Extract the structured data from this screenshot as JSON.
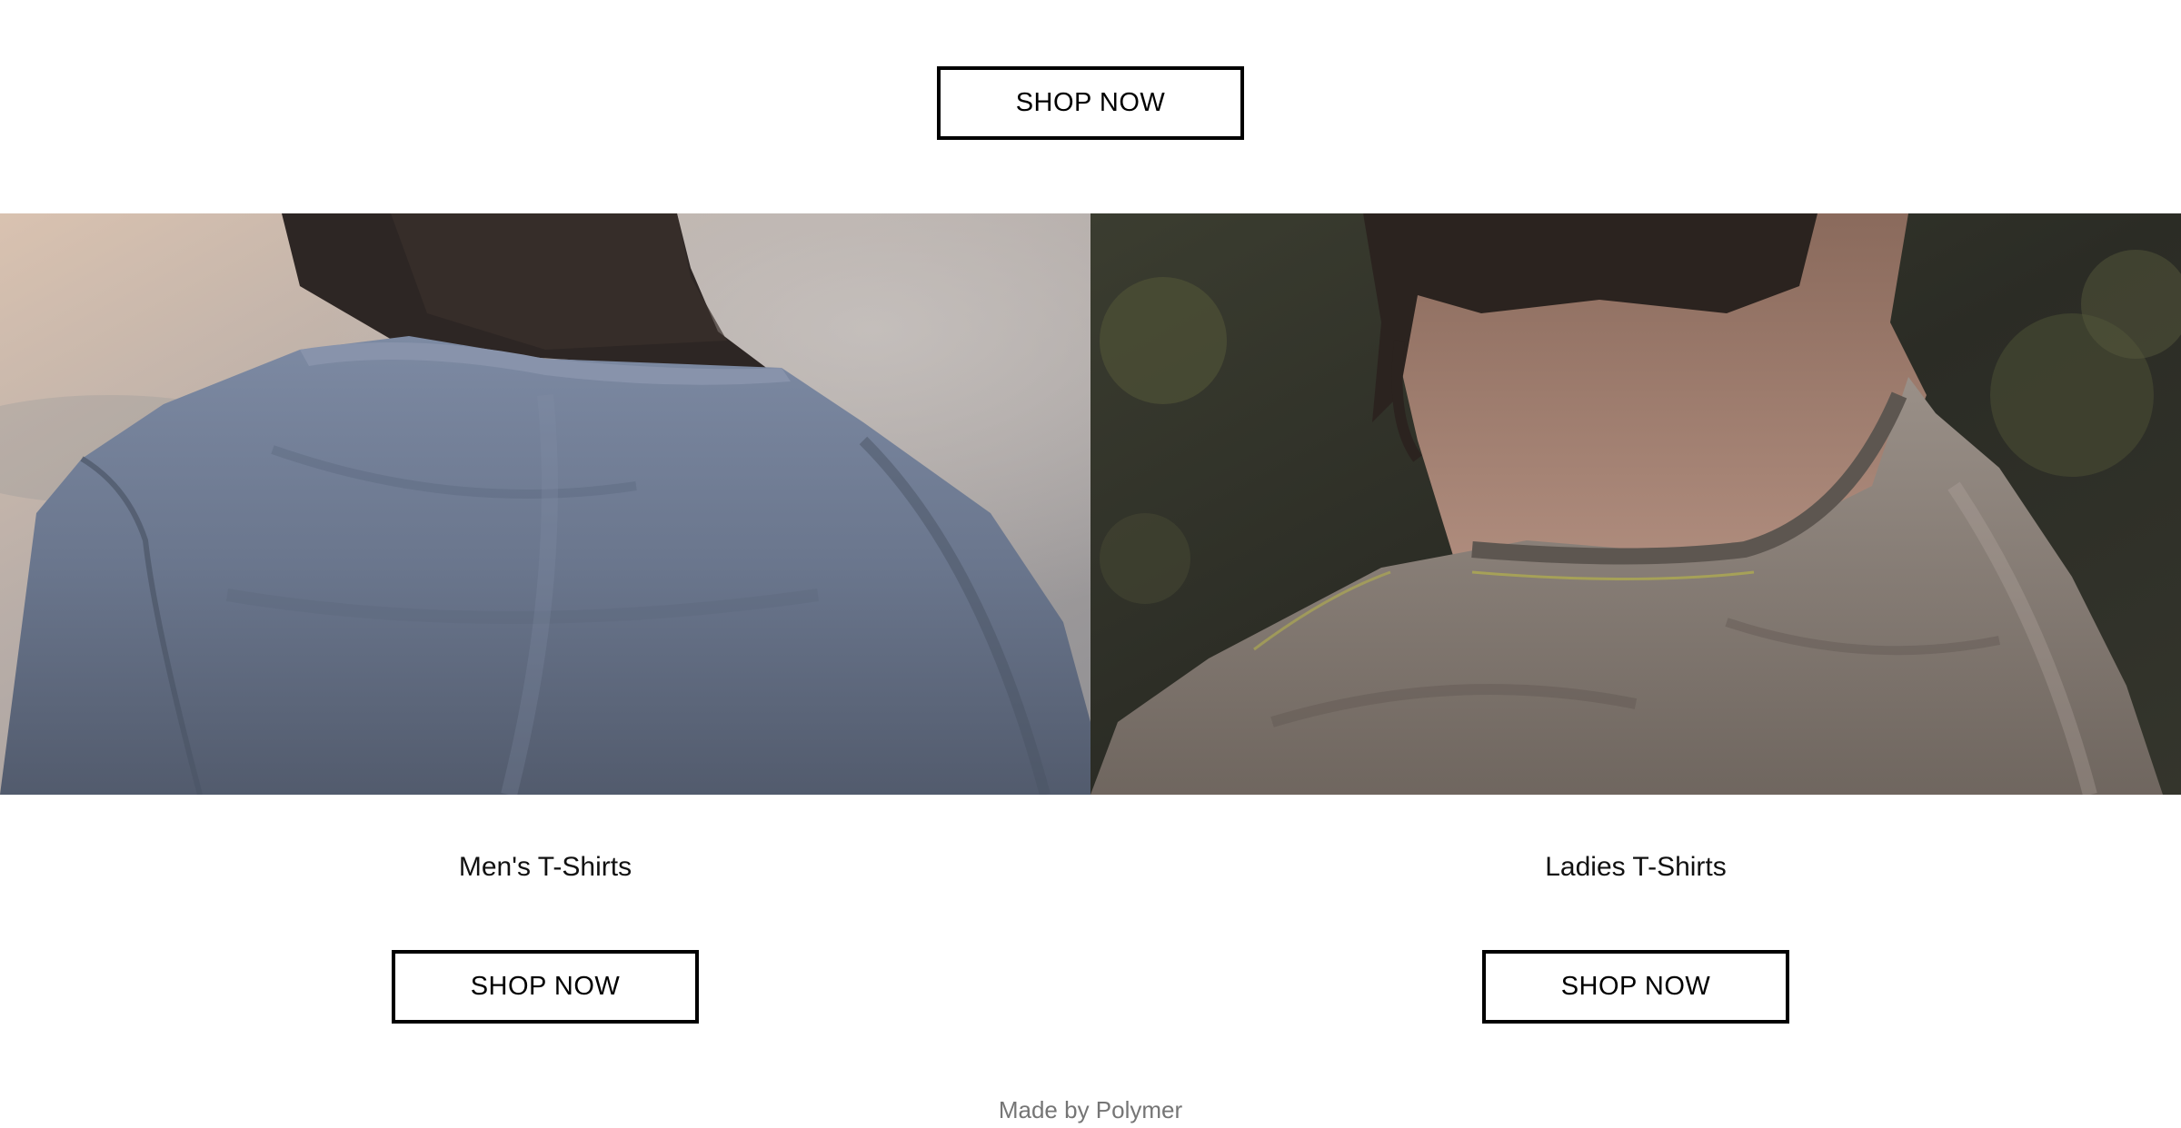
{
  "top": {
    "shop_label": "SHOP NOW"
  },
  "categories": [
    {
      "title": "Men's T-Shirts",
      "shop_label": "SHOP NOW",
      "image": "man-blue-tshirt-back-photo"
    },
    {
      "title": "Ladies T-Shirts",
      "shop_label": "SHOP NOW",
      "image": "woman-grey-tshirt-back-photo"
    }
  ],
  "footer": {
    "credit": "Made by Polymer"
  },
  "colors": {
    "button_border": "#000000",
    "footer_text": "#757575",
    "background": "#ffffff"
  }
}
